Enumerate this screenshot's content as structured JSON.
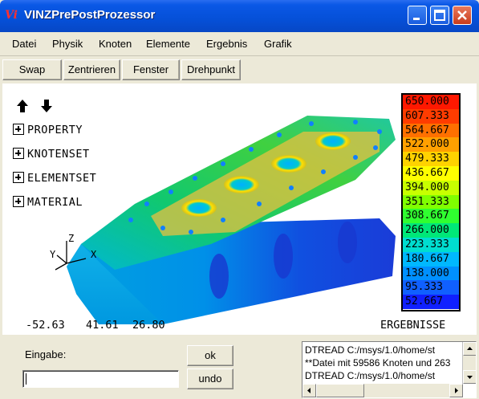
{
  "window": {
    "title": "VINZPrePostProzessor",
    "icon_glyph": "Vi"
  },
  "menubar": {
    "items": [
      "Datei",
      "Physik",
      "Knoten",
      "Elemente",
      "Ergebnis",
      "Grafik"
    ]
  },
  "toolbar": {
    "buttons": [
      "Swap",
      "Zentrieren",
      "Fenster",
      "Drehpunkt"
    ]
  },
  "viewport": {
    "tree": [
      "PROPERTY",
      "KNOTENSET",
      "ELEMENTSET",
      "MATERIAL"
    ],
    "axes": {
      "z": "Z",
      "y": "Y",
      "x": "X"
    },
    "coords": [
      "-52.63",
      "41.61",
      "26.80"
    ],
    "results_label": "ERGEBNISSE",
    "legend": {
      "values": [
        "650.000",
        "607.333",
        "564.667",
        "522.000",
        "479.333",
        "436.667",
        "394.000",
        "351.333",
        "308.667",
        "266.000",
        "223.333",
        "180.667",
        "138.000",
        "95.333",
        "52.667"
      ],
      "colors": [
        "#ff1800",
        "#ff3c00",
        "#ff7000",
        "#ffa000",
        "#ffd200",
        "#ffff00",
        "#c8ff00",
        "#80ff00",
        "#30ff30",
        "#00e878",
        "#00ddd0",
        "#00b8ff",
        "#0090ff",
        "#1060ff",
        "#1020ff"
      ]
    }
  },
  "bottom": {
    "input_label": "Eingabe:",
    "input_value": "",
    "ok_label": "ok",
    "undo_label": "undo",
    "log_lines": [
      "DTREAD C:/msys/1.0/home/st",
      "**Datei mit 59586 Knoten und 263",
      "DTREAD C:/msys/1.0/home/st"
    ]
  }
}
